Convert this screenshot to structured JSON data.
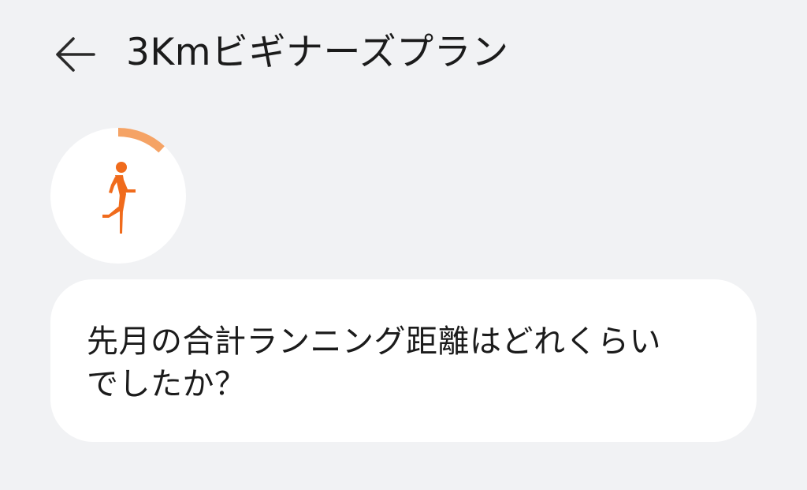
{
  "header": {
    "back_icon": "arrow-left-icon",
    "title": "3Kmビギナーズプラン"
  },
  "coach": {
    "avatar_icon": "runner-icon",
    "progress_fraction": 0.12,
    "colors": {
      "accent": "#f06b1c",
      "progress": "#f5a365"
    }
  },
  "message": {
    "text": "先月の合計ランニング距離はどれくらいでしたか？"
  }
}
